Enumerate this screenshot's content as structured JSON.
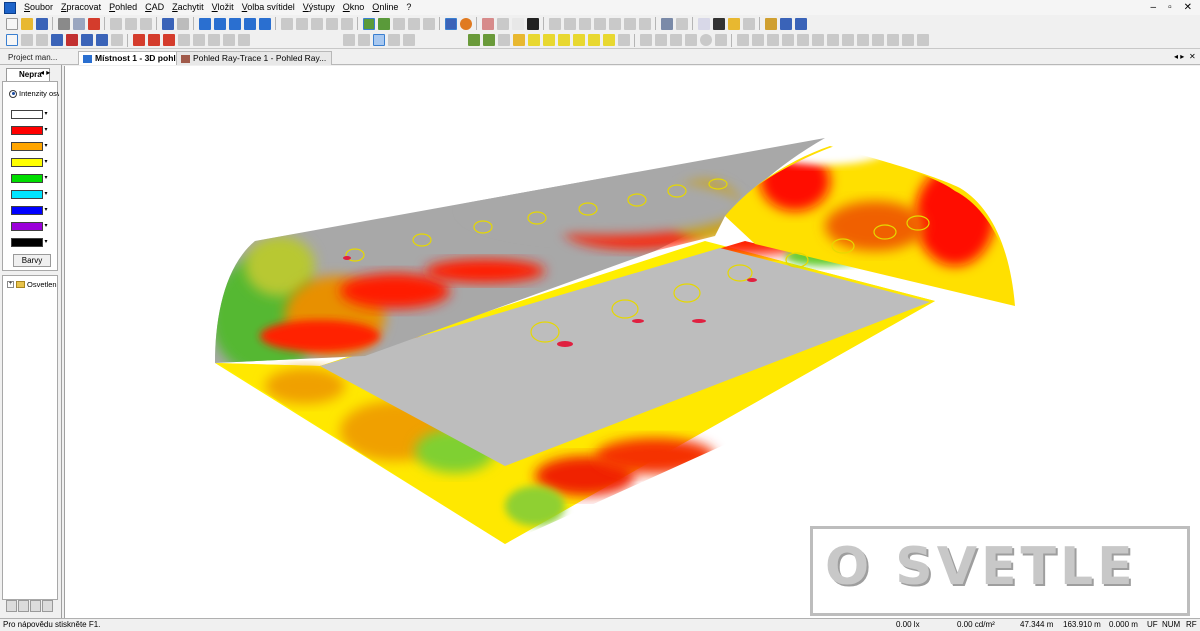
{
  "menu": [
    "Soubor",
    "Zpracovat",
    "Pohled",
    "CAD",
    "Zachytit",
    "Vložit",
    "Volba svítidel",
    "Výstupy",
    "Okno",
    "Online",
    "?"
  ],
  "window_controls": [
    "–",
    "▫",
    "✕"
  ],
  "tabs": {
    "project_tab": "Project man...",
    "doc_tabs": [
      {
        "label": "Místnost 1 - 3D pohled",
        "active": true
      },
      {
        "label": "Pohled Ray-Trace 1 - Pohled Ray...",
        "active": false
      }
    ],
    "controls": [
      "◂ ▸",
      "✕"
    ]
  },
  "left_panel": {
    "tab_label": "Nepra",
    "tab_arrows": "◂ ▸",
    "radio_label": "Intenzity osv",
    "swatches": [
      {
        "color": "#ffffff"
      },
      {
        "color": "#ff0000"
      },
      {
        "color": "#ffa500"
      },
      {
        "color": "#ffff00"
      },
      {
        "color": "#00dd00"
      },
      {
        "color": "#00e5ff"
      },
      {
        "color": "#0000ff"
      },
      {
        "color": "#9b00d9"
      },
      {
        "color": "#000000"
      }
    ],
    "barvy_button": "Barvy",
    "tree_item": "Osvetlen",
    "tree_expander": "+"
  },
  "viewport": {
    "watermark_text": "O SVETLE"
  },
  "status": {
    "help": "Pro nápovědu stiskněte F1.",
    "lux": "0.00 lx",
    "luminance": "0.00 cd/m²",
    "x": "47.344 m",
    "y": "163.910 m",
    "z": "0.000 m",
    "uf": "UF",
    "num": "NUM",
    "rf": "RF"
  },
  "colors": {
    "accent": "#1d63c9",
    "heat_red": "#ff0000",
    "heat_yellow": "#ffff00",
    "heat_green": "#33cc33",
    "floor_gray": "#bdbdbd",
    "ceiling_gray": "#a8a8a8"
  }
}
